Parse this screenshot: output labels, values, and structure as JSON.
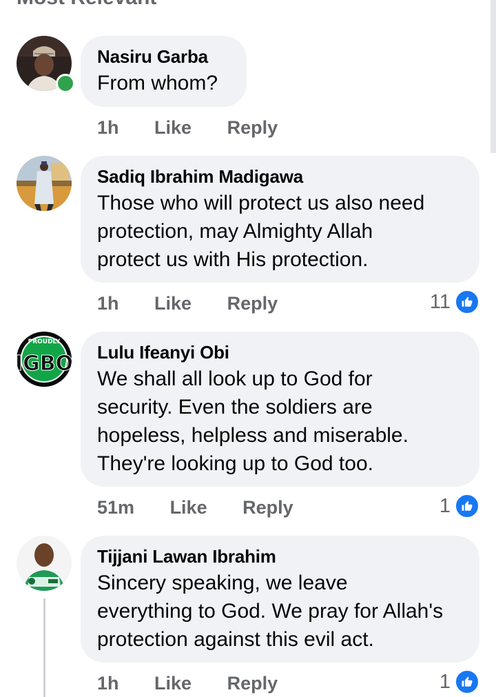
{
  "sort": {
    "label": "Most Relevant"
  },
  "comments": [
    {
      "author": "Nasiru Garba",
      "lines": [
        "From whom?"
      ],
      "time": "1h",
      "like_label": "Like",
      "reply_label": "Reply",
      "reactions": null,
      "online": true
    },
    {
      "author": "Sadiq Ibrahim Madigawa",
      "lines": [
        "Those who will protect us also need",
        "protection, may Almighty Allah",
        "protect us with His protection."
      ],
      "time": "1h",
      "like_label": "Like",
      "reply_label": "Reply",
      "reactions": "11",
      "online": false
    },
    {
      "author": "Lulu Ifeanyi Obi",
      "lines": [
        "We shall all look up to God for",
        "security. Even the soldiers are",
        "hopeless, helpless and miserable.",
        "They're looking up to God too."
      ],
      "time": "51m",
      "like_label": "Like",
      "reply_label": "Reply",
      "reactions": "1",
      "online": false
    },
    {
      "author": "Tijjani Lawan Ibrahim",
      "lines": [
        "Sincery speaking, we leave",
        "everything to God. We pray for Allah's",
        "protection against this evil act."
      ],
      "time": "1h",
      "like_label": "Like",
      "reply_label": "Reply",
      "reactions": "1",
      "online": false
    }
  ],
  "icons": {
    "reaction": "thumbs-up-icon",
    "online": "online-status-icon"
  },
  "colors": {
    "bubble": "#f0f2f5",
    "meta": "#65676b",
    "like_blue": "#1877f2",
    "online_green": "#31a24c"
  }
}
